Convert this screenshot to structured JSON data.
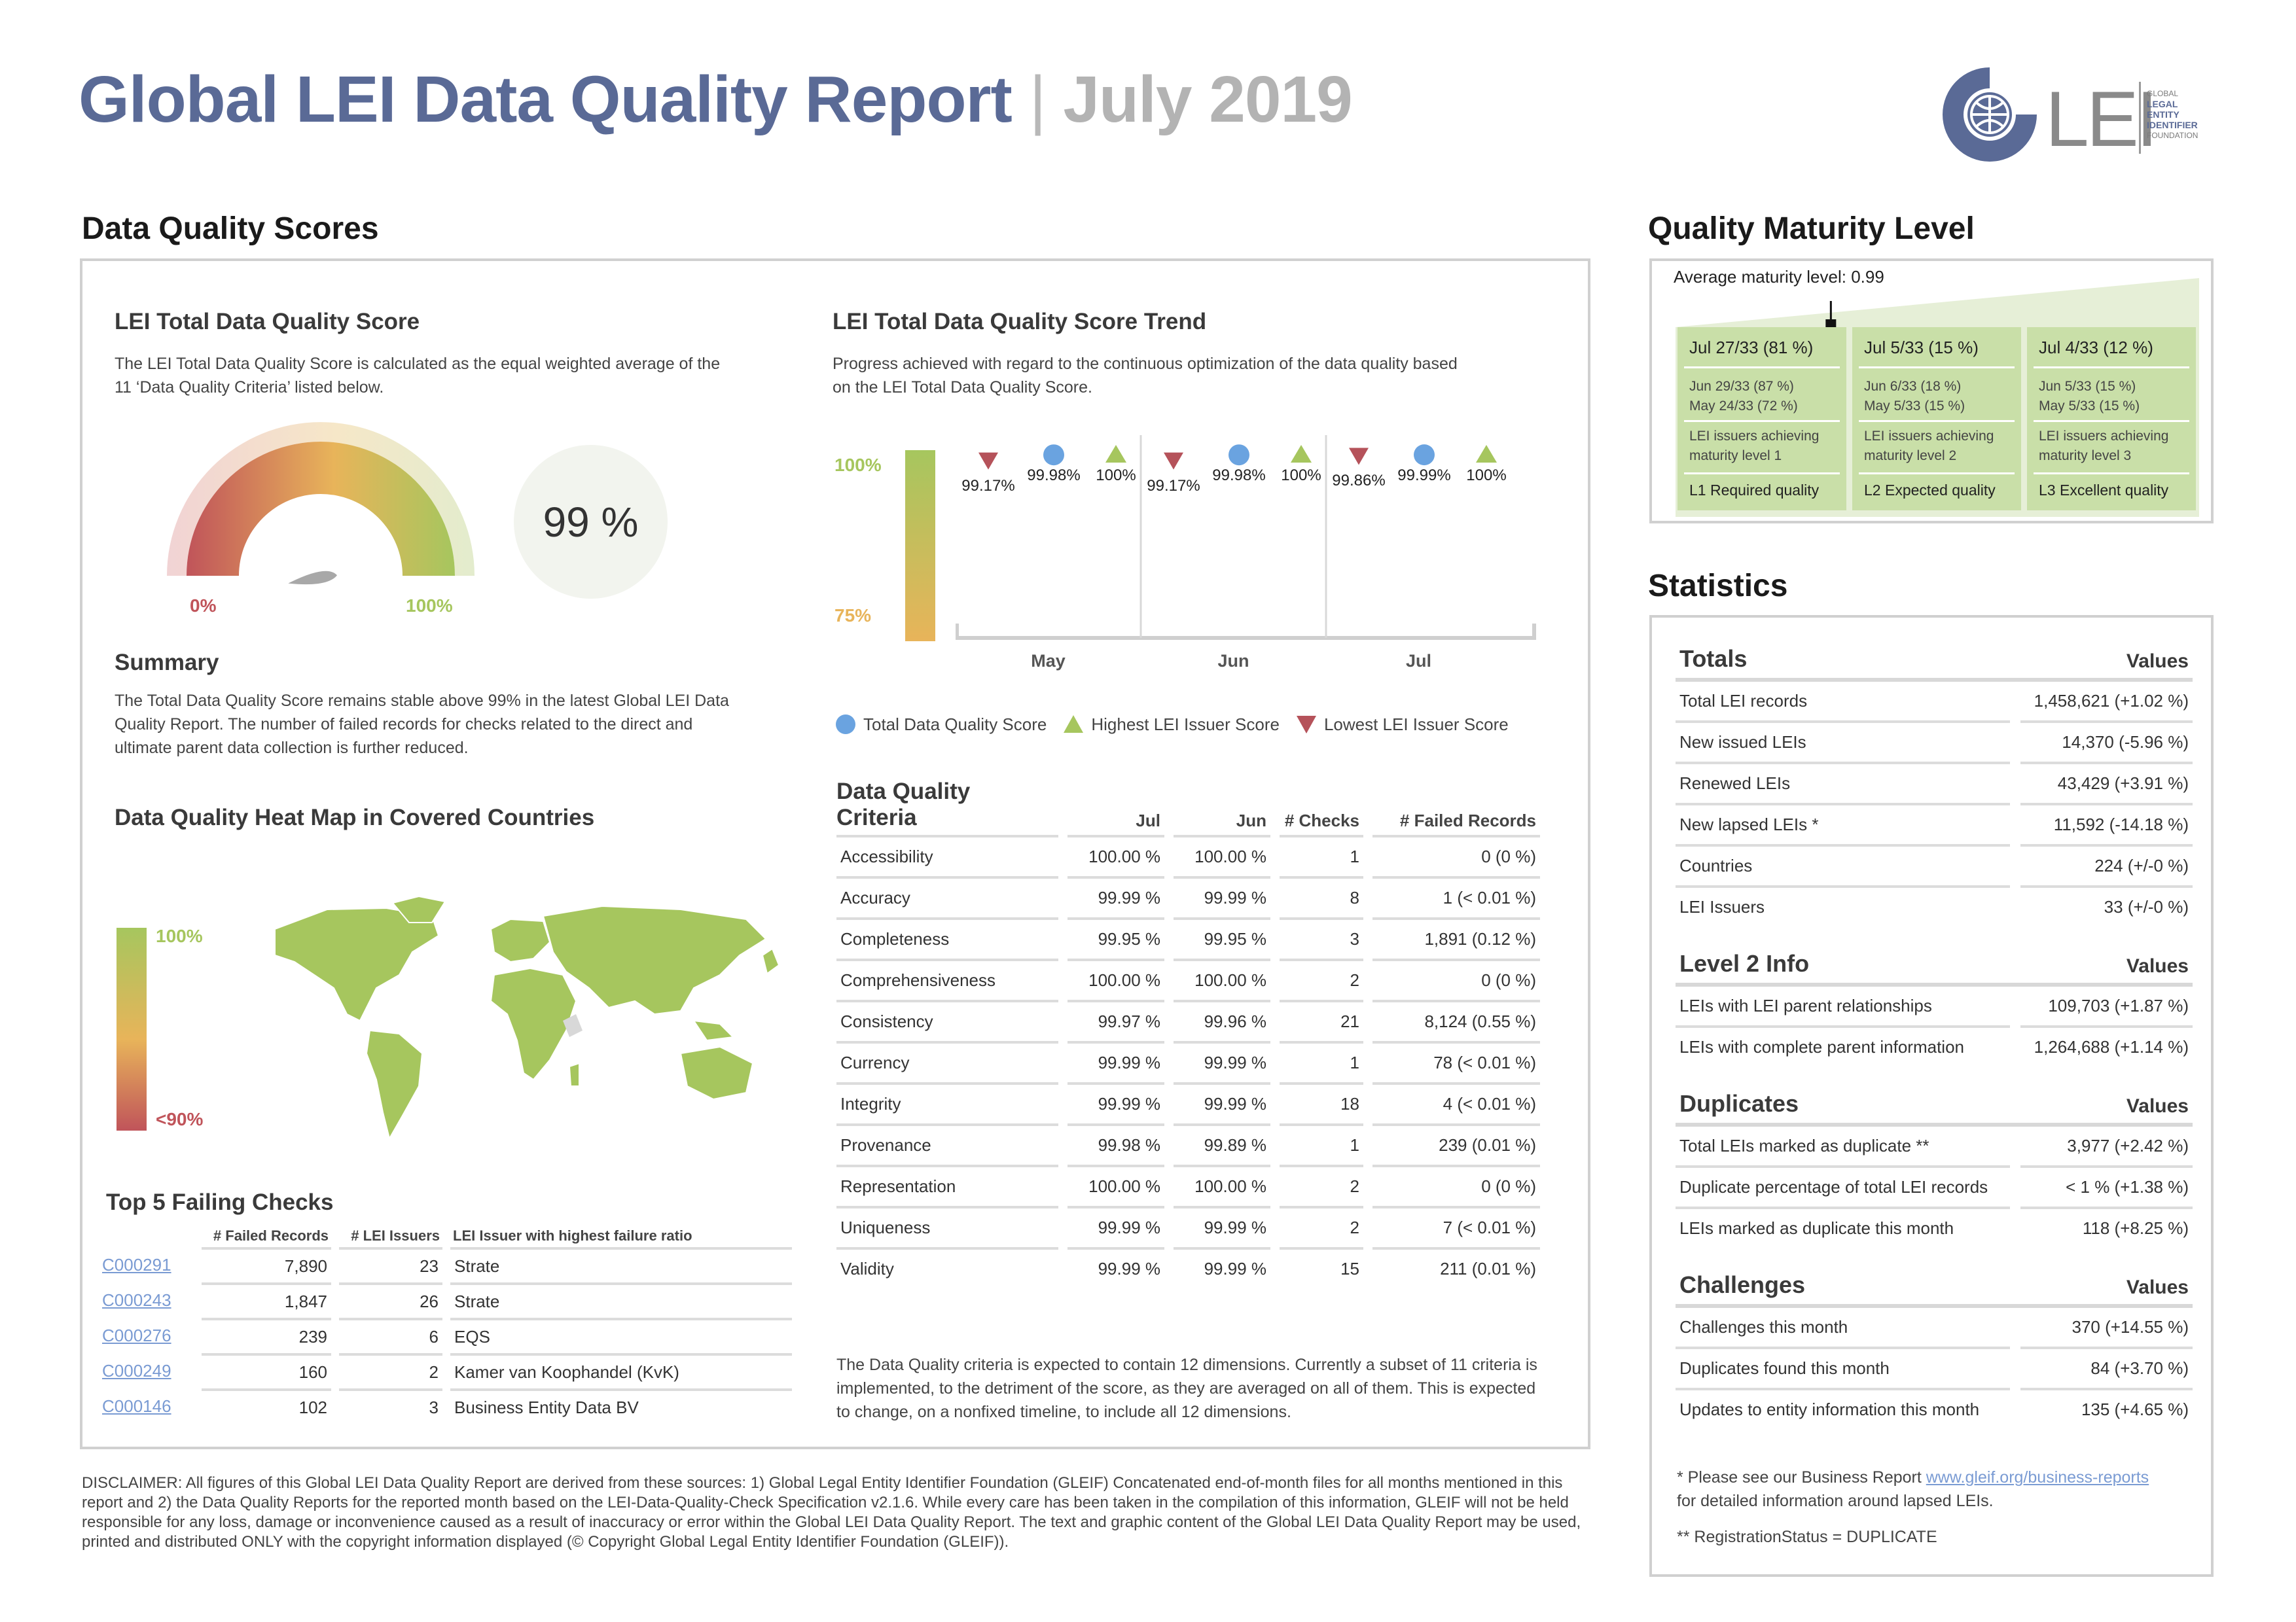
{
  "header": {
    "title": "Global LEI Data Quality Report",
    "separator": "|",
    "month": "July 2019",
    "logo_text": "LEI",
    "logo_words": [
      "GLOBAL",
      "LEGAL",
      "ENTITY",
      "IDENTIFIER",
      "FOUNDATION"
    ]
  },
  "dq_scores": {
    "heading": "Data Quality Scores",
    "total_score": {
      "title": "LEI Total Data Quality Score",
      "description": "The LEI Total Data Quality Score is calculated as the equal weighted average of the 11 ‘Data Quality Criteria’ listed below.",
      "gauge_min": "0%",
      "gauge_max": "100%",
      "score_text": "99 %",
      "gauge_value": 0.99
    },
    "summary": {
      "title": "Summary",
      "text": "The Total Data Quality Score remains stable above 99% in the latest Global LEI Data Quality Report. The number of failed records for checks related to the direct and ultimate parent data collection is further reduced."
    },
    "heatmap": {
      "title": "Data Quality Heat Map in Covered Countries",
      "scale_top": "100%",
      "scale_bottom": "<90%",
      "colors": {
        "high": "#a6c65e",
        "mid": "#e8b45a",
        "low": "#c0545a"
      }
    },
    "trend": {
      "title": "LEI Total Data Quality Score Trend",
      "description": "Progress achieved with regard to the continuous optimization of the data quality based on the LEI Total Data Quality Score.",
      "axis_top": "100%",
      "axis_bottom": "75%",
      "months": [
        "May",
        "Jun",
        "Jul"
      ],
      "lowest": [
        "99.17%",
        "99.17%",
        "99.86%"
      ],
      "total": [
        "99.98%",
        "99.98%",
        "99.99%"
      ],
      "highest": [
        "100%",
        "100%",
        "100%"
      ],
      "legend": {
        "total": "Total Data Quality Score",
        "highest": "Highest LEI Issuer Score",
        "lowest": "Lowest LEI Issuer Score"
      },
      "colors": {
        "total": "#6aa3e0",
        "highest": "#a6c65e",
        "lowest": "#b5525a"
      }
    },
    "criteria": {
      "title": "Data Quality Criteria",
      "headers": [
        "Jul",
        "Jun",
        "# Checks",
        "# Failed Records"
      ],
      "rows": [
        [
          "Accessibility",
          "100.00 %",
          "100.00 %",
          "1",
          "0 (0 %)"
        ],
        [
          "Accuracy",
          "99.99 %",
          "99.99 %",
          "8",
          "1 (< 0.01 %)"
        ],
        [
          "Completeness",
          "99.95 %",
          "99.95 %",
          "3",
          "1,891 (0.12 %)"
        ],
        [
          "Comprehensiveness",
          "100.00 %",
          "100.00 %",
          "2",
          "0 (0 %)"
        ],
        [
          "Consistency",
          "99.97 %",
          "99.96 %",
          "21",
          "8,124 (0.55 %)"
        ],
        [
          "Currency",
          "99.99 %",
          "99.99 %",
          "1",
          "78 (< 0.01 %)"
        ],
        [
          "Integrity",
          "99.99 %",
          "99.99 %",
          "18",
          "4 (< 0.01 %)"
        ],
        [
          "Provenance",
          "99.98 %",
          "99.89 %",
          "1",
          "239 (0.01 %)"
        ],
        [
          "Representation",
          "100.00 %",
          "100.00 %",
          "2",
          "0 (0 %)"
        ],
        [
          "Uniqueness",
          "99.99 %",
          "99.99 %",
          "2",
          "7 (< 0.01 %)"
        ],
        [
          "Validity",
          "99.99 %",
          "99.99 %",
          "15",
          "211 (0.01 %)"
        ]
      ],
      "footnote": "The Data Quality criteria is expected to contain 12 dimensions. Currently a subset of 11 criteria is implemented, to the detriment of the score, as they are averaged on all of them. This is expected to change, on a nonfixed timeline, to include all 12 dimensions."
    },
    "failing": {
      "title": "Top 5 Failing Checks",
      "headers": [
        "# Failed Records",
        "# LEI Issuers",
        "LEI Issuer with highest failure ratio"
      ],
      "rows": [
        [
          "C000291",
          "7,890",
          "23",
          "Strate"
        ],
        [
          "C000243",
          "1,847",
          "26",
          "Strate"
        ],
        [
          "C000276",
          "239",
          "6",
          "EQS"
        ],
        [
          "C000249",
          "160",
          "2",
          "Kamer van Koophandel (KvK)"
        ],
        [
          "C000146",
          "102",
          "3",
          "Business Entity Data BV"
        ]
      ]
    }
  },
  "maturity": {
    "heading": "Quality Maturity Level",
    "average": "Average maturity level: 0.99",
    "average_value": 0.99,
    "levels": [
      {
        "head": "Jul 27/33 (81 %)",
        "hist1": "Jun 29/33 (87 %)",
        "hist2": "May 24/33 (72 %)",
        "desc1": "LEI issuers achieving",
        "desc2": "maturity level 1",
        "foot": "L1 Required quality"
      },
      {
        "head": "Jul 5/33 (15 %)",
        "hist1": "Jun 6/33 (18 %)",
        "hist2": "May 5/33 (15 %)",
        "desc1": "LEI issuers achieving",
        "desc2": "maturity level 2",
        "foot": "L2 Expected quality"
      },
      {
        "head": "Jul 4/33 (12 %)",
        "hist1": "Jun 5/33 (15 %)",
        "hist2": "May 5/33 (15 %)",
        "desc1": "LEI issuers achieving",
        "desc2": "maturity level 3",
        "foot": "L3 Excellent quality"
      }
    ]
  },
  "statistics": {
    "heading": "Statistics",
    "values_label": "Values",
    "groups": [
      {
        "name": "Totals",
        "rows": [
          [
            "Total LEI records",
            "1,458,621 (+1.02 %)"
          ],
          [
            "New issued LEIs",
            "14,370 (-5.96 %)"
          ],
          [
            "Renewed LEIs",
            "43,429 (+3.91 %)"
          ],
          [
            "New lapsed LEIs *",
            "11,592 (-14.18 %)"
          ],
          [
            "Countries",
            "224 (+/-0 %)"
          ],
          [
            "LEI Issuers",
            "33 (+/-0 %)"
          ]
        ]
      },
      {
        "name": "Level 2 Info",
        "rows": [
          [
            "LEIs with LEI parent relationships",
            "109,703 (+1.87 %)"
          ],
          [
            "LEIs with complete parent information",
            "1,264,688 (+1.14 %)"
          ]
        ]
      },
      {
        "name": "Duplicates",
        "rows": [
          [
            "Total LEIs marked as duplicate **",
            "3,977 (+2.42 %)"
          ],
          [
            "Duplicate percentage of total LEI records",
            "< 1 % (+1.38 %)"
          ],
          [
            "LEIs marked as duplicate this month",
            "118 (+8.25 %)"
          ]
        ]
      },
      {
        "name": "Challenges",
        "rows": [
          [
            "Challenges this month",
            "370 (+14.55 %)"
          ],
          [
            "Duplicates found this month",
            "84 (+3.70 %)"
          ],
          [
            "Updates to entity information this month",
            "135 (+4.65 %)"
          ]
        ]
      }
    ],
    "note1_pre": "* Please see our Business Report ",
    "note1_link": "www.gleif.org/business-reports",
    "note1_post": "for detailed information around lapsed LEIs.",
    "note2": "** RegistrationStatus = DUPLICATE"
  },
  "disclaimer": "DISCLAIMER: All figures of this Global LEI Data Quality Report are derived from these sources: 1) Global Legal Entity Identifier Foundation (GLEIF) Concatenated end-of-month files for all months mentioned in this report and 2) the Data Quality Reports for the reported month based on the LEI-Data-Quality-Check Specification v2.1.6. While every care has been taken in the compilation of this information, GLEIF will not be held responsible for any loss, damage or inconvenience caused as a result of inaccuracy or error within the Global LEI Data Quality Report. The text and graphic content of the Global LEI Data Quality Report may be used, printed and distributed ONLY with the copyright information displayed (© Copyright Global Legal Entity Identifier Foundation (GLEIF))."
}
